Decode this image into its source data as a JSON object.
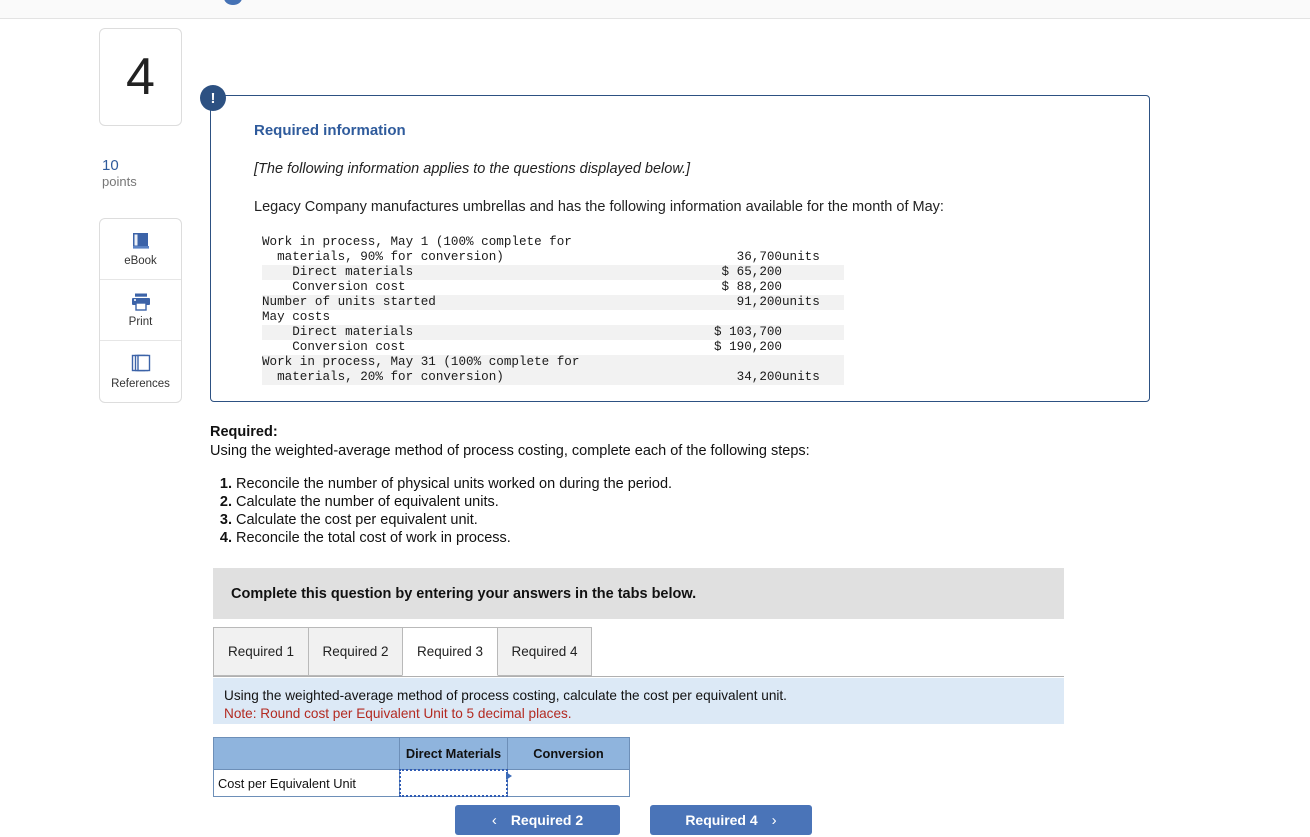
{
  "sidebar": {
    "question_number": "4",
    "points_value": "10",
    "points_label": "points",
    "tools": [
      {
        "label": "eBook",
        "icon": "book-icon"
      },
      {
        "label": "Print",
        "icon": "printer-icon"
      },
      {
        "label": "References",
        "icon": "references-icon"
      }
    ]
  },
  "callout": {
    "badge": "!",
    "heading": "Required information",
    "italic_note": "[The following information applies to the questions displayed below.]",
    "lead": "Legacy Company manufactures umbrellas and has the following information available for the month of May:",
    "table_rows": [
      {
        "label": "Work in process, May 1 (100% complete for",
        "value": "",
        "unit": "",
        "shaded": false
      },
      {
        "label": "  materials, 90% for conversion)",
        "value": "36,700",
        "unit": "units",
        "shaded": false
      },
      {
        "label": "    Direct materials",
        "value": "$ 65,200",
        "unit": "",
        "shaded": true
      },
      {
        "label": "    Conversion cost",
        "value": "$ 88,200",
        "unit": "",
        "shaded": false
      },
      {
        "label": "Number of units started",
        "value": "91,200",
        "unit": "units",
        "shaded": true
      },
      {
        "label": "May costs",
        "value": "",
        "unit": "",
        "shaded": false
      },
      {
        "label": "    Direct materials",
        "value": "$ 103,700",
        "unit": "",
        "shaded": true
      },
      {
        "label": "    Conversion cost",
        "value": "$ 190,200",
        "unit": "",
        "shaded": false
      },
      {
        "label": "Work in process, May 31 (100% complete for",
        "value": "",
        "unit": "",
        "shaded": true
      },
      {
        "label": "  materials, 20% for conversion)",
        "value": "34,200",
        "unit": "units",
        "shaded": true
      }
    ]
  },
  "required": {
    "heading": "Required:",
    "subheading": "Using the weighted-average method of process costing, complete each of the following steps:",
    "steps": [
      "Reconcile the number of physical units worked on during the period.",
      "Calculate the number of equivalent units.",
      "Calculate the cost per equivalent unit.",
      "Reconcile the total cost of work in process."
    ]
  },
  "gray_banner": {
    "text": "Complete this question by entering your answers in the tabs below."
  },
  "tabs": {
    "active_index": 2,
    "items": [
      {
        "label": "Required 1"
      },
      {
        "label": "Required 2"
      },
      {
        "label": "Required 3"
      },
      {
        "label": "Required 4"
      }
    ]
  },
  "instruction": {
    "line1": "Using the weighted-average method of process costing, calculate the cost per equivalent unit.",
    "note": "Note: Round cost per Equivalent Unit to 5 decimal places."
  },
  "answer_table": {
    "headers": [
      "",
      "Direct Materials",
      "Conversion"
    ],
    "rows": [
      {
        "label": "Cost per Equivalent Unit",
        "direct_materials": "",
        "conversion": ""
      }
    ]
  },
  "navigation": {
    "prev_label": "Required 2",
    "next_label": "Required 4",
    "prev_chevron": "‹",
    "next_chevron": "›"
  },
  "colors": {
    "accent_blue": "#2f5b9c",
    "callout_border": "#2d5182",
    "badge_bg": "#2d5182",
    "table_header_blue": "#8fb4dd",
    "banner_blue": "#dce9f6",
    "note_red": "#b32a21",
    "gray_banner": "#e0e0e0",
    "button_blue": "#4a74b8"
  }
}
